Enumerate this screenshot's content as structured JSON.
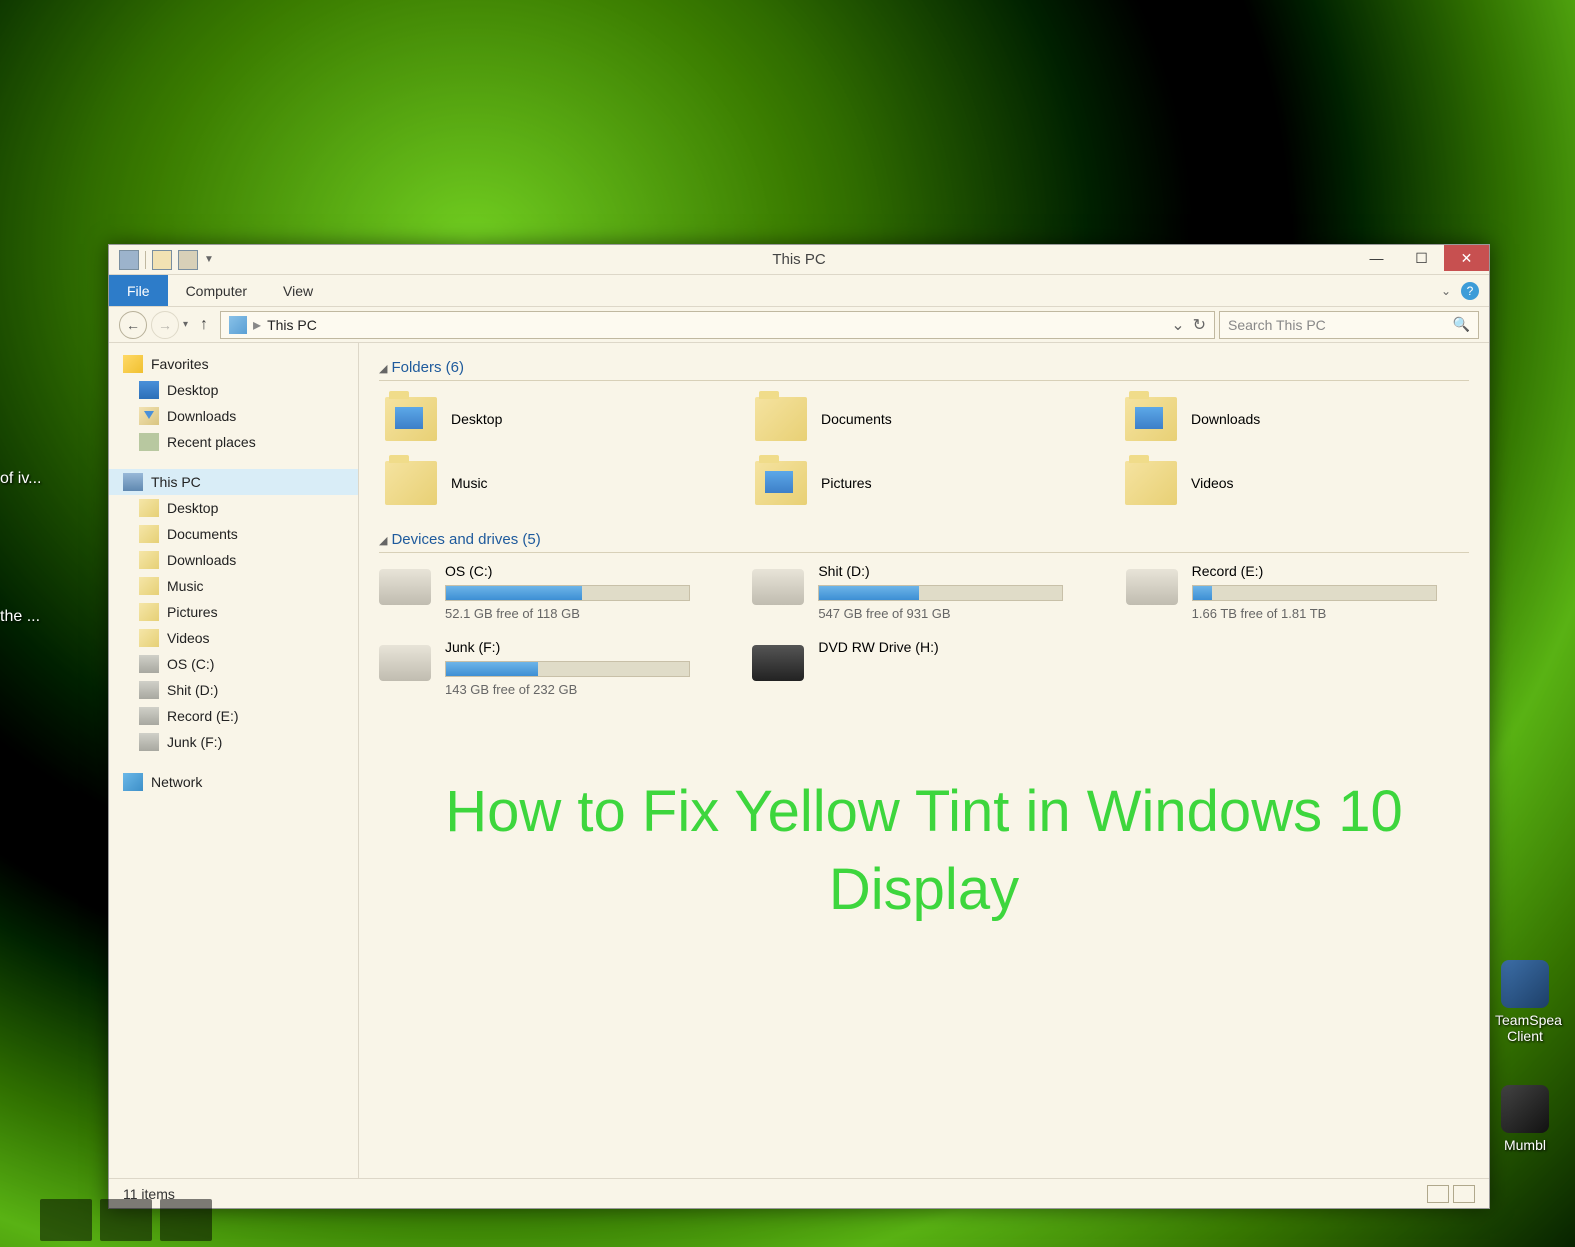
{
  "window": {
    "title": "This PC",
    "ribbon_tabs": {
      "file": "File",
      "computer": "Computer",
      "view": "View"
    },
    "breadcrumb": "This PC",
    "search_placeholder": "Search This PC",
    "status": "11 items"
  },
  "sidebar": {
    "favorites": {
      "label": "Favorites",
      "items": [
        "Desktop",
        "Downloads",
        "Recent places"
      ]
    },
    "this_pc": {
      "label": "This PC",
      "items": [
        "Desktop",
        "Documents",
        "Downloads",
        "Music",
        "Pictures",
        "Videos",
        "OS (C:)",
        "Shit (D:)",
        "Record (E:)",
        "Junk (F:)"
      ]
    },
    "network": {
      "label": "Network"
    }
  },
  "content": {
    "folders_header": "Folders (6)",
    "folders": [
      "Desktop",
      "Documents",
      "Downloads",
      "Music",
      "Pictures",
      "Videos"
    ],
    "drives_header": "Devices and drives (5)",
    "drives": [
      {
        "name": "OS (C:)",
        "free": "52.1 GB free of 118 GB",
        "pct": 56
      },
      {
        "name": "Shit (D:)",
        "free": "547 GB free of 931 GB",
        "pct": 41
      },
      {
        "name": "Record (E:)",
        "free": "1.66 TB free of 1.81 TB",
        "pct": 8
      },
      {
        "name": "Junk (F:)",
        "free": "143 GB free of 232 GB",
        "pct": 38
      },
      {
        "name": "DVD RW Drive (H:)",
        "free": "",
        "pct": null
      }
    ]
  },
  "overlay": "How to Fix Yellow Tint in Windows 10 Display",
  "desktop_icons": {
    "left1": "of\niv...",
    "left2": "the\n...",
    "right1": "TeamSpea\nClient",
    "right2": "Mumbl"
  }
}
